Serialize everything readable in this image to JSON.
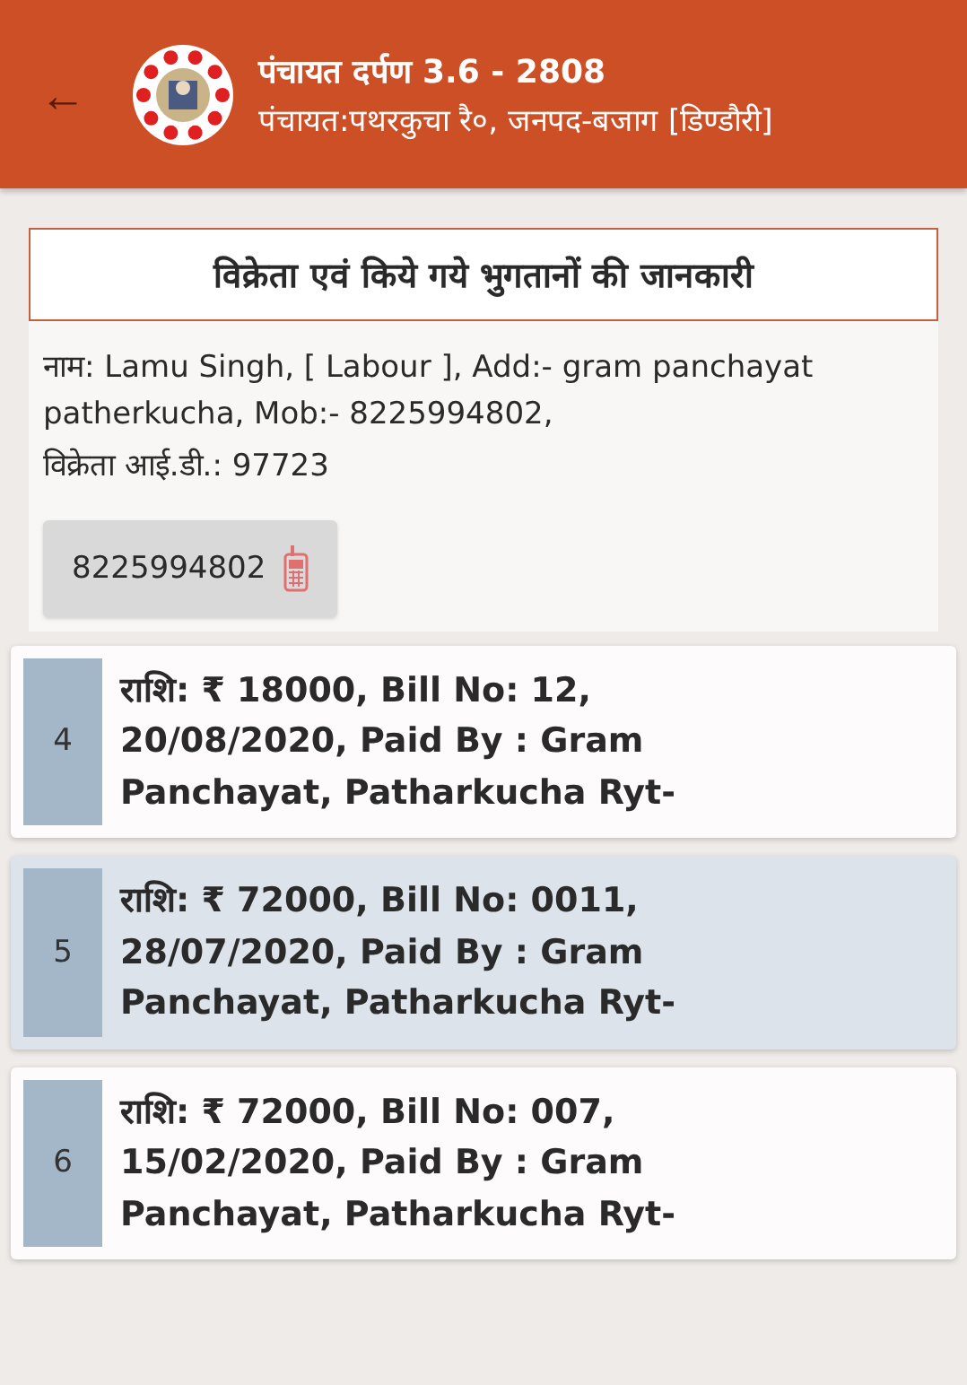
{
  "header": {
    "back_icon": "←",
    "title": "पंचायत दर्पण 3.6 - 2808",
    "subtitle": "पंचायत:पथरकुचा रै०, जनपद-बजाग [डिण्डौरी]"
  },
  "section_title": "विक्रेता एवं किये गये भुगतानों की जानकारी",
  "vendor": {
    "name_label": "नाम:",
    "name_text": "Lamu Singh, [ Labour ], Add:- gram panchayat patherkucha, Mob:- 8225994802,",
    "id_label": "विक्रेता आई.डी.:",
    "id_value": "97723",
    "phone": "8225994802"
  },
  "payments": [
    {
      "number": "4",
      "text": "राशि: ₹ 18000, Bill No: 12, 20/08/2020, Paid By : Gram Panchayat, Patharkucha Ryt-",
      "selected": false
    },
    {
      "number": "5",
      "text": "राशि: ₹ 72000, Bill No: 0011, 28/07/2020, Paid By : Gram Panchayat, Patharkucha Ryt-",
      "selected": true
    },
    {
      "number": "6",
      "text": "राशि: ₹ 72000, Bill No: 007, 15/02/2020, Paid By : Gram Panchayat, Patharkucha Ryt-",
      "selected": false
    }
  ]
}
